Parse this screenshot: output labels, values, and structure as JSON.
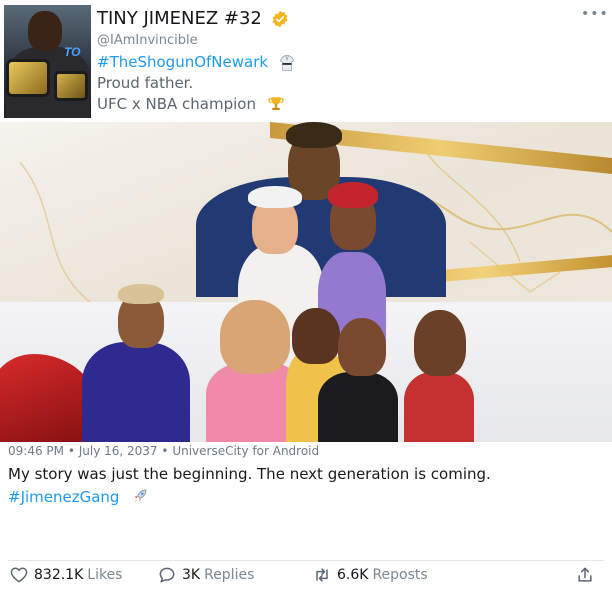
{
  "profile": {
    "display_name": "TINY JIMENEZ #32",
    "handle": "@IAmInvincible",
    "bio_hashtag": "#TheShogunOfNewark",
    "bio_line2": "Proud father.",
    "bio_line3": "UFC x NBA champion",
    "verified_icon": "verified-badge-icon",
    "avatar_logo_text": "TO"
  },
  "post": {
    "time": "09:46 PM",
    "date": "July 16, 2037",
    "source": "UniverseCity for Android",
    "text": "My story was just the beginning. The next generation is coming.",
    "hashtag": "#JimenezGang"
  },
  "actions": {
    "likes_count": "832.1K",
    "likes_label": "Likes",
    "replies_count": "3K",
    "replies_label": "Replies",
    "reposts_count": "6.6K",
    "reposts_label": "Reposts"
  },
  "colors": {
    "link": "#1d9bf0",
    "verified": "#f2b51d",
    "muted": "#7b8791"
  }
}
